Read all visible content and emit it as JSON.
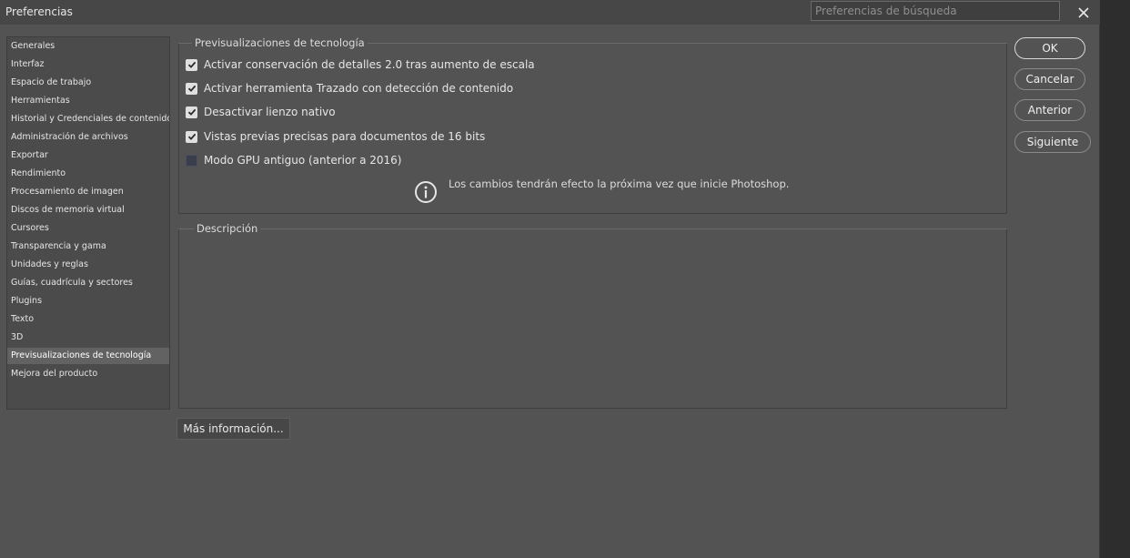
{
  "window": {
    "title": "Preferencias",
    "search_placeholder": "Preferencias de búsqueda"
  },
  "sidebar": {
    "items": [
      {
        "label": "Generales"
      },
      {
        "label": "Interfaz"
      },
      {
        "label": "Espacio de trabajo"
      },
      {
        "label": "Herramientas"
      },
      {
        "label": "Historial y Credenciales de contenido"
      },
      {
        "label": "Administración de archivos"
      },
      {
        "label": "Exportar"
      },
      {
        "label": "Rendimiento"
      },
      {
        "label": "Procesamiento de imagen"
      },
      {
        "label": "Discos de memoria virtual"
      },
      {
        "label": "Cursores"
      },
      {
        "label": "Transparencia y gama"
      },
      {
        "label": "Unidades y reglas"
      },
      {
        "label": "Guías, cuadrícula y sectores"
      },
      {
        "label": "Plugins"
      },
      {
        "label": "Texto"
      },
      {
        "label": "3D"
      },
      {
        "label": "Previsualizaciones de tecnología"
      },
      {
        "label": "Mejora del producto"
      }
    ],
    "selected": "Previsualizaciones de tecnología"
  },
  "tech_previews": {
    "legend": "Previsualizaciones de tecnología",
    "options": [
      {
        "label": "Activar conservación de detalles 2.0 tras aumento de escala",
        "checked": true
      },
      {
        "label": "Activar herramienta Trazado con detección de contenido",
        "checked": true
      },
      {
        "label": "Desactivar lienzo nativo",
        "checked": true
      },
      {
        "label": "Vistas previas precisas para documentos de 16 bits",
        "checked": true
      },
      {
        "label": "Modo GPU antiguo (anterior a 2016)",
        "checked": false
      }
    ],
    "notice": "Los cambios tendrán efecto la próxima vez que inicie Photoshop."
  },
  "description": {
    "legend": "Descripción"
  },
  "buttons": {
    "ok": "OK",
    "cancel": "Cancelar",
    "previous": "Anterior",
    "next": "Siguiente",
    "more_info": "Más información..."
  },
  "colors": {
    "dialog_bg": "#535353",
    "titlebar_bg": "#474747",
    "sidebar_selected": "#626262",
    "checkbox_on": "#e0e0e0",
    "checkbox_off": "#3a3e4c"
  }
}
